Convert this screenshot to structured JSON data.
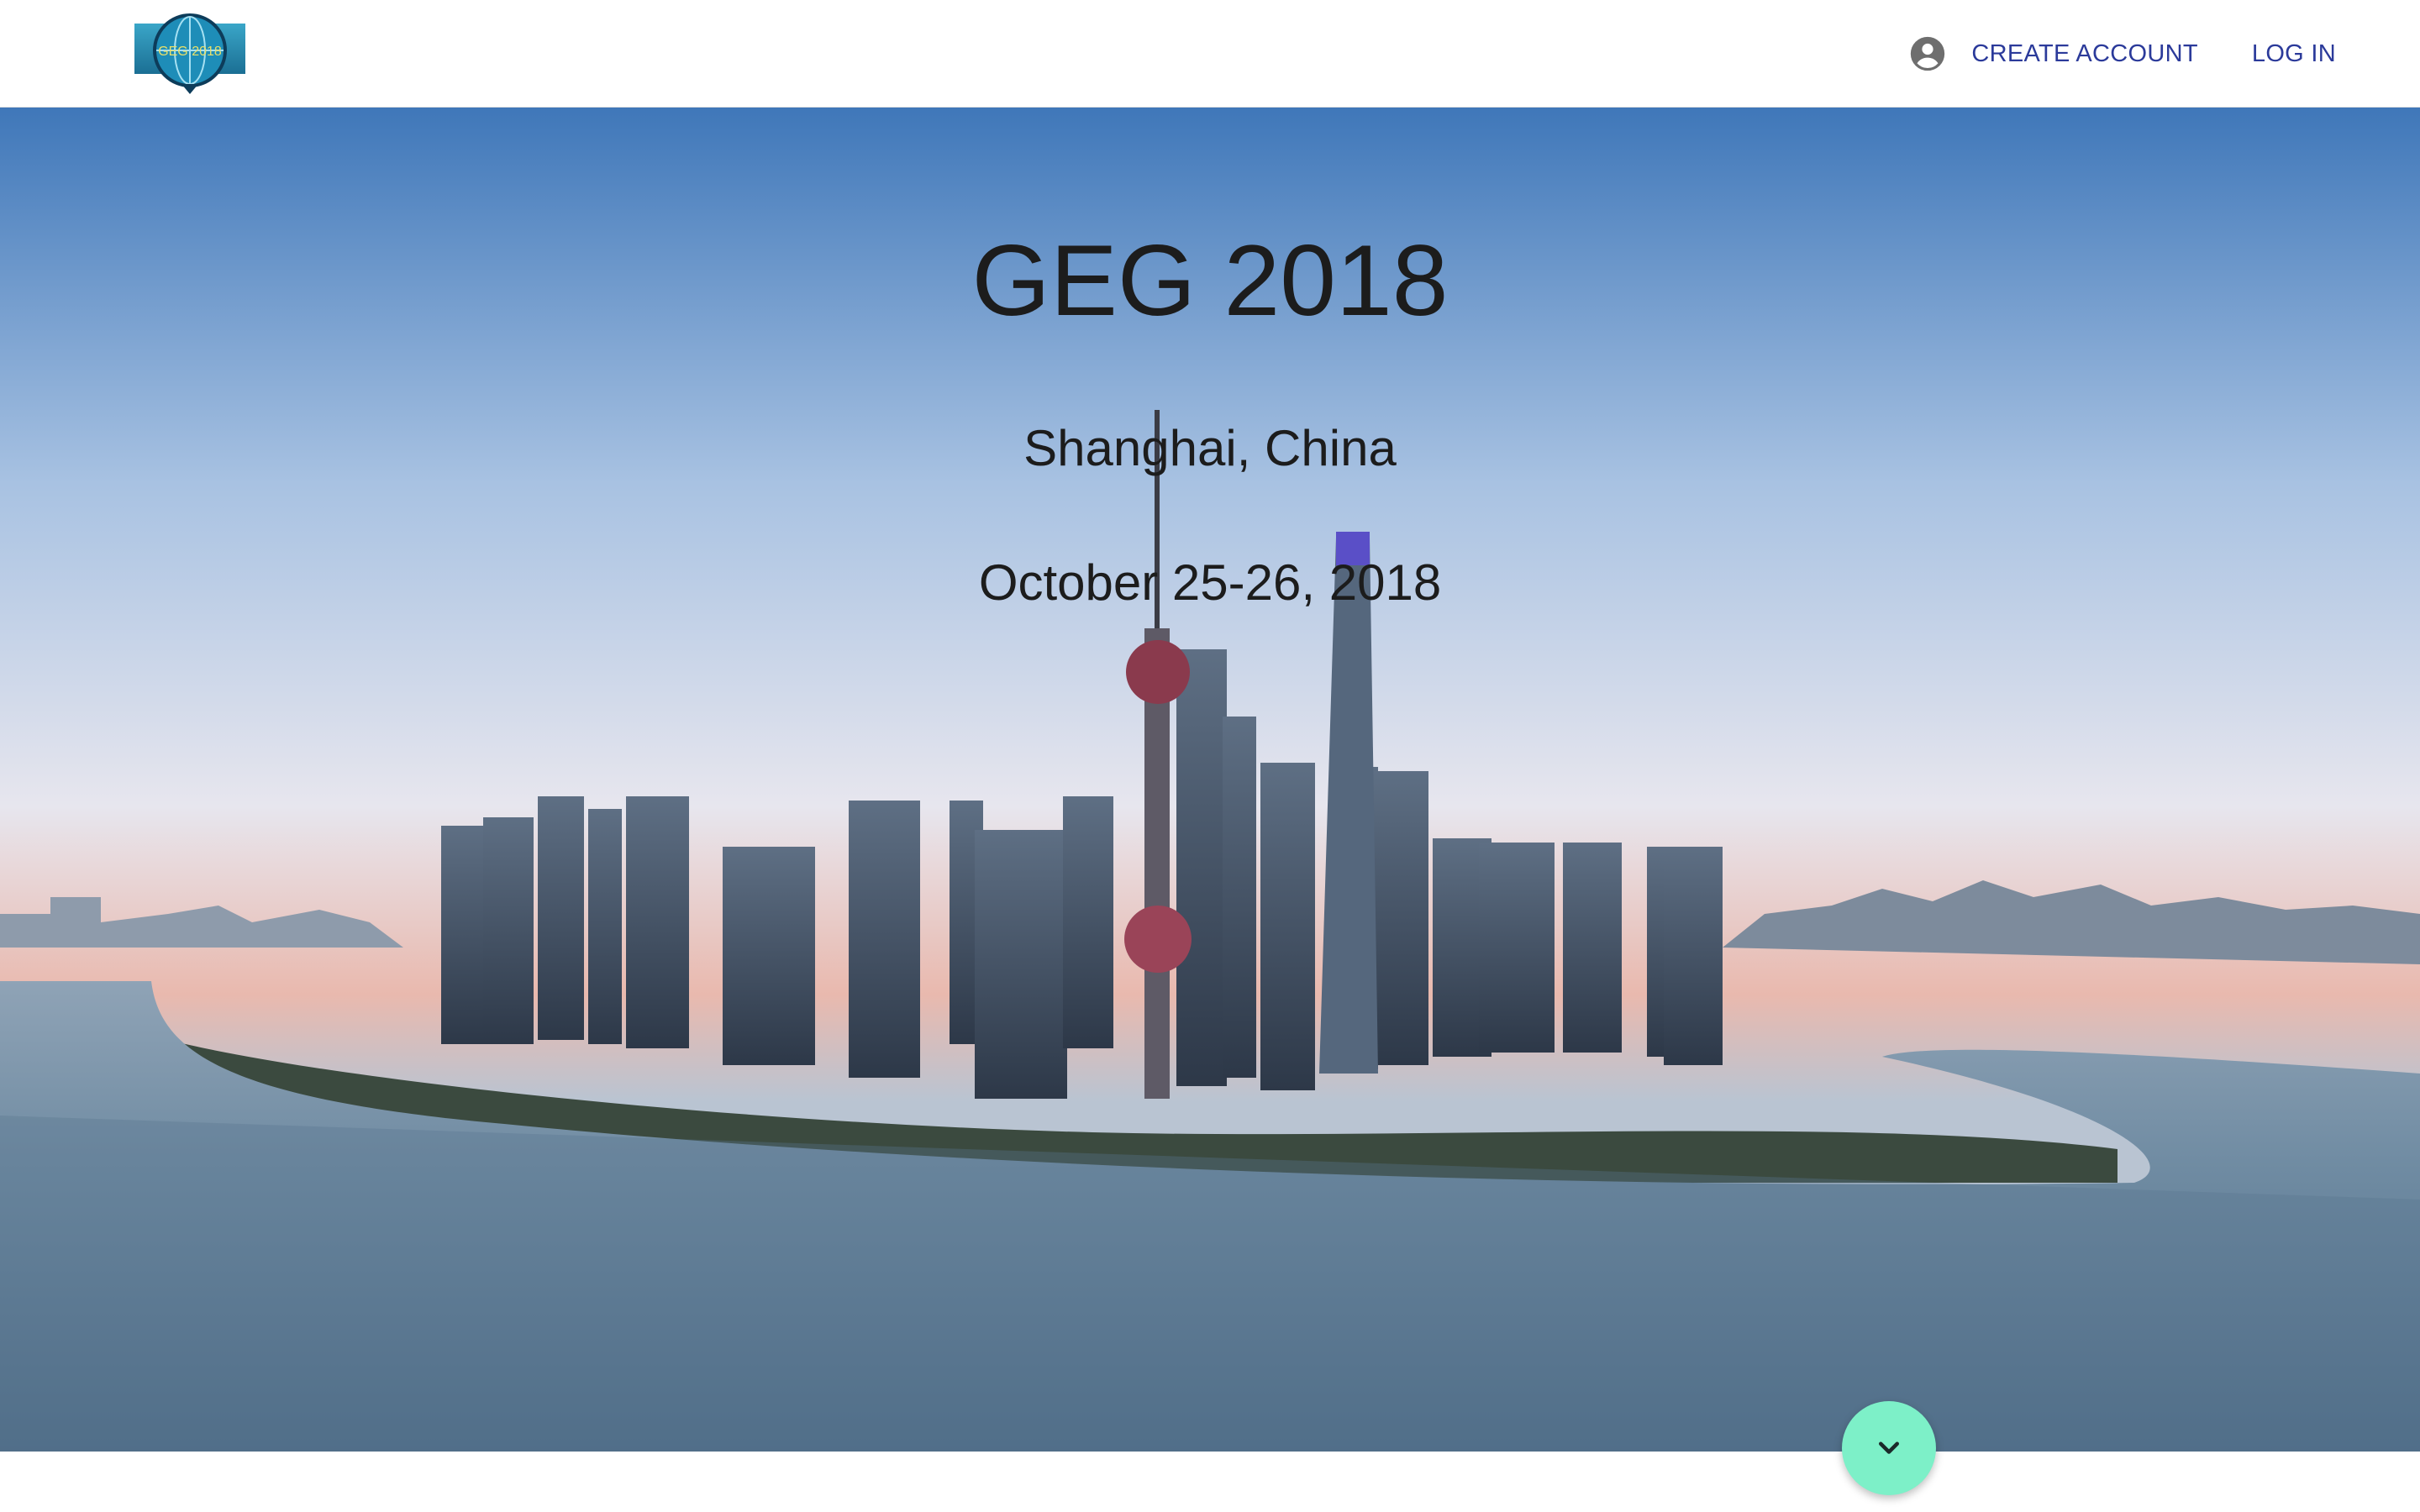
{
  "header": {
    "logo_text": "GEG 2018",
    "account_icon": "account-circle-icon",
    "create_account_label": "CREATE ACCOUNT",
    "login_label": "LOG IN"
  },
  "hero": {
    "title": "GEG 2018",
    "location": "Shanghai, China",
    "dates": "October 25-26, 2018",
    "background": "shanghai-skyline-photo",
    "scroll_icon": "chevron-down-icon"
  },
  "colors": {
    "nav_link": "#2b3a9a",
    "scroll_button": "#7df0c8",
    "hero_text": "#1c1c1c"
  }
}
